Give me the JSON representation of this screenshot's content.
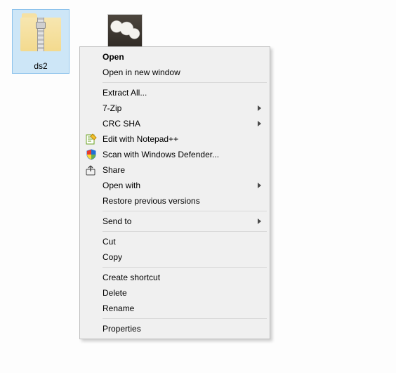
{
  "files": {
    "zip": {
      "label": "ds2"
    },
    "photo": {
      "label": ""
    }
  },
  "menu": {
    "open": "Open",
    "open_new_window": "Open in new window",
    "extract_all": "Extract All...",
    "seven_zip": "7-Zip",
    "crc_sha": "CRC SHA",
    "edit_npp": "Edit with Notepad++",
    "scan_defender": "Scan with Windows Defender...",
    "share": "Share",
    "open_with": "Open with",
    "restore_versions": "Restore previous versions",
    "send_to": "Send to",
    "cut": "Cut",
    "copy": "Copy",
    "create_shortcut": "Create shortcut",
    "delete": "Delete",
    "rename": "Rename",
    "properties": "Properties"
  }
}
